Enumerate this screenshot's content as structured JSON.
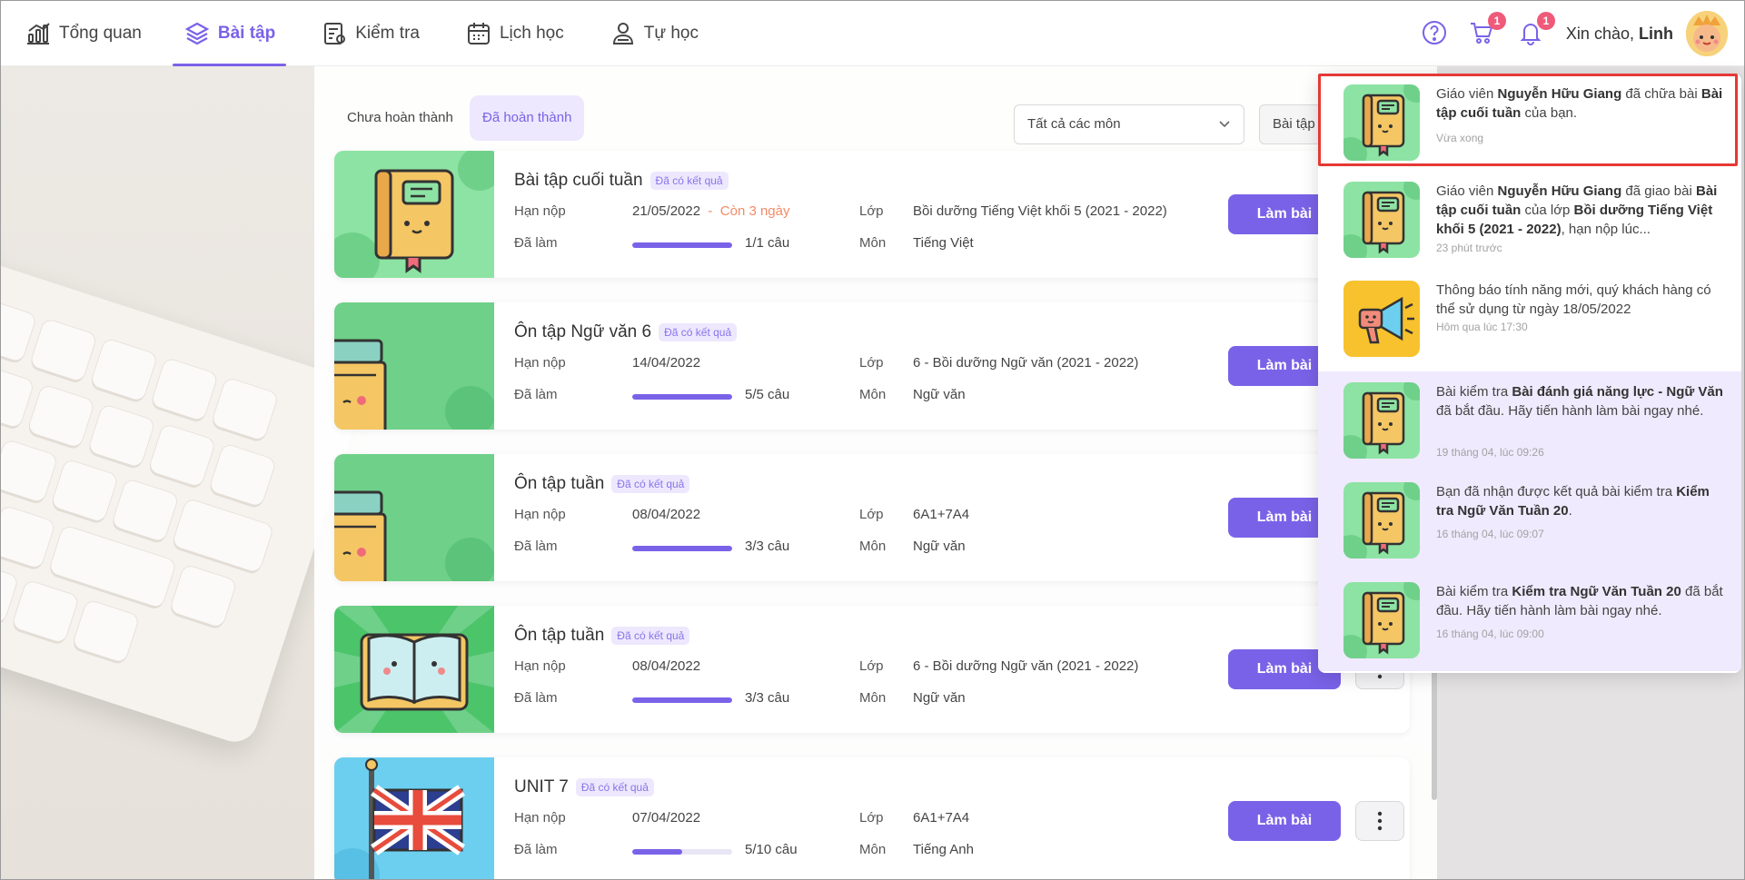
{
  "nav": {
    "items": [
      {
        "label": "Tổng quan",
        "icon": "chart-icon"
      },
      {
        "label": "Bài tập",
        "icon": "layers-icon",
        "active": true
      },
      {
        "label": "Kiểm tra",
        "icon": "test-icon"
      },
      {
        "label": "Lịch học",
        "icon": "calendar-icon"
      },
      {
        "label": "Tự học",
        "icon": "self-study-icon"
      }
    ],
    "greeting": "Xin chào,",
    "user_name": "Linh",
    "cart_count": "1",
    "notification_count": "1"
  },
  "filters": {
    "tab_incomplete": "Chưa hoàn thành",
    "tab_complete": "Đã hoàn thành",
    "subject_select": "Tất cả các môn",
    "type_select": "Bài tập"
  },
  "cards": [
    {
      "title": "Bài tập cuối tuần",
      "tag": "Đã có kết quả",
      "deadline_label": "Hạn nộp",
      "deadline": "21/05/2022",
      "separator": "-",
      "remaining": "Còn 3 ngày",
      "done_label": "Đã làm",
      "progress_text": "1/1 câu",
      "progress": 1.0,
      "class_label": "Lớp",
      "class": "Bồi dưỡng Tiếng Việt khối 5 (2021 - 2022)",
      "subject_label": "Môn",
      "subject": "Tiếng Việt",
      "button": "Làm bài",
      "thumb": "book-character"
    },
    {
      "title": "Ôn tập Ngữ văn 6",
      "tag": "Đã có kết quả",
      "deadline_label": "Hạn nộp",
      "deadline": "14/04/2022",
      "done_label": "Đã làm",
      "progress_text": "5/5 câu",
      "progress": 1.0,
      "class_label": "Lớp",
      "class": "6 - Bồi dưỡng Ngữ văn (2021 - 2022)",
      "subject_label": "Môn",
      "subject": "Ngữ văn",
      "button": "Làm bài",
      "thumb": "book-stack"
    },
    {
      "title": "Ôn tập tuần",
      "tag": "Đã có kết quả",
      "deadline_label": "Hạn nộp",
      "deadline": "08/04/2022",
      "done_label": "Đã làm",
      "progress_text": "3/3 câu",
      "progress": 1.0,
      "class_label": "Lớp",
      "class": "6A1+7A4",
      "subject_label": "Môn",
      "subject": "Ngữ văn",
      "button": "Làm bài",
      "thumb": "book-stack"
    },
    {
      "title": "Ôn tập tuần",
      "tag": "Đã có kết quả",
      "deadline_label": "Hạn nộp",
      "deadline": "08/04/2022",
      "done_label": "Đã làm",
      "progress_text": "3/3 câu",
      "progress": 1.0,
      "class_label": "Lớp",
      "class": "6 - Bồi dưỡng Ngữ văn (2021 - 2022)",
      "subject_label": "Môn",
      "subject": "Ngữ văn",
      "button": "Làm bài",
      "thumb": "open-book"
    },
    {
      "title": "UNIT 7",
      "tag": "Đã có kết quả",
      "deadline_label": "Hạn nộp",
      "deadline": "07/04/2022",
      "done_label": "Đã làm",
      "progress_text": "5/10 câu",
      "progress": 0.5,
      "class_label": "Lớp",
      "class": "6A1+7A4",
      "subject_label": "Môn",
      "subject": "Tiếng Anh",
      "button": "Làm bài",
      "thumb": "uk-flag"
    }
  ],
  "notifications": [
    {
      "parts": [
        "Giáo viên ",
        "Nguyễn Hữu Giang",
        " đã chữa bài ",
        "Bài tập cuối tuần",
        " của bạn."
      ],
      "time": "Vừa xong",
      "unread": false,
      "thumb": "book-character"
    },
    {
      "parts": [
        "Giáo viên ",
        "Nguyễn Hữu Giang",
        " đã giao bài ",
        "Bài tập cuối tuần",
        " của lớp ",
        "Bồi dưỡng Tiếng Việt khối 5 (2021 - 2022)",
        ", hạn nộp lúc..."
      ],
      "time": "23 phút trước",
      "unread": false,
      "thumb": "book-character"
    },
    {
      "parts": [
        "Thông báo tính năng mới, quý khách hàng có thể sử dụng từ ngày 18/05/2022"
      ],
      "time": "Hôm qua lúc 17:30",
      "unread": false,
      "thumb": "megaphone"
    },
    {
      "parts": [
        "Bài kiểm tra ",
        "Bài đánh giá năng lực - Ngữ Văn",
        " đã bắt đầu. Hãy tiến hành làm bài ngay nhé."
      ],
      "time": "19 tháng 04, lúc 09:26",
      "unread": true,
      "thumb": "book-character"
    },
    {
      "parts": [
        "Bạn đã nhận được kết quả bài kiểm tra ",
        "Kiểm tra Ngữ Văn Tuần 20",
        "."
      ],
      "time": "16 tháng 04, lúc 09:07",
      "unread": true,
      "thumb": "book-character"
    },
    {
      "parts": [
        "Bài kiểm tra ",
        "Kiểm tra Ngữ Văn Tuần 20",
        " đã bắt đầu. Hãy tiến hành làm bài ngay nhé."
      ],
      "time": "16 tháng 04, lúc 09:00",
      "unread": true,
      "thumb": "book-character"
    }
  ],
  "colors": {
    "accent": "#7a62e8",
    "accent_soft": "#ede8fd",
    "remaining": "#f28b66",
    "badge": "#ef5a7a",
    "highlight": "#e53935"
  }
}
